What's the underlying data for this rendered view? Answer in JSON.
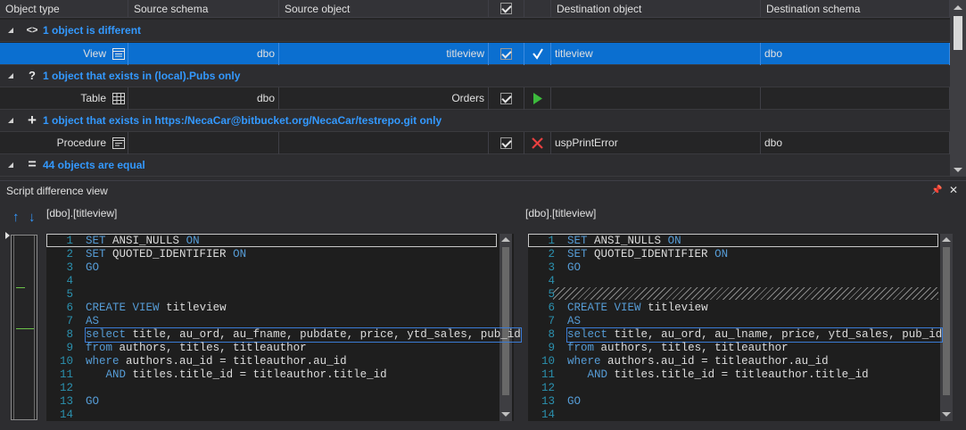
{
  "grid": {
    "columns": [
      "Object type",
      "Source schema",
      "Source object",
      "",
      "",
      "Destination object",
      "Destination schema"
    ],
    "groups": [
      {
        "label": "1 object is different",
        "icon": "<>"
      },
      {
        "label": "1 object that exists in (local).Pubs only",
        "icon": "?"
      },
      {
        "label": "1 object that exists in https:/NecaCar@bitbucket.org/NecaCar/testrepo.git only",
        "icon": "+"
      },
      {
        "label": "44 objects are equal",
        "icon": "="
      }
    ],
    "rows": [
      {
        "type": "View",
        "source_schema": "dbo",
        "source_object": "titleview",
        "dest_object": "titleview",
        "dest_schema": "dbo"
      },
      {
        "type": "Table",
        "source_schema": "dbo",
        "source_object": "Orders",
        "dest_object": "",
        "dest_schema": ""
      },
      {
        "type": "Procedure",
        "source_schema": "",
        "source_object": "",
        "dest_object": "uspPrintError",
        "dest_schema": "dbo"
      }
    ]
  },
  "panel": {
    "title": "Script difference view",
    "pin": "📌",
    "close": "✕",
    "up": "↑",
    "down": "↓",
    "left_object": "[dbo].[titleview]",
    "right_object": "[dbo].[titleview]"
  },
  "script_left": [
    {
      "n": "1",
      "t": "SET ANSI_NULLS ON"
    },
    {
      "n": "2",
      "t": "SET QUOTED_IDENTIFIER ON"
    },
    {
      "n": "3",
      "t": "GO"
    },
    {
      "n": "4",
      "t": ""
    },
    {
      "n": "5",
      "t": ""
    },
    {
      "n": "6",
      "t": "CREATE VIEW titleview"
    },
    {
      "n": "7",
      "t": "AS"
    },
    {
      "n": "8",
      "t": "select title, au_ord, au_fname, pubdate, price, ytd_sales, pub_id"
    },
    {
      "n": "9",
      "t": "from authors, titles, titleauthor"
    },
    {
      "n": "10",
      "t": "where authors.au_id = titleauthor.au_id"
    },
    {
      "n": "11",
      "t": "   AND titles.title_id = titleauthor.title_id"
    },
    {
      "n": "12",
      "t": ""
    },
    {
      "n": "13",
      "t": "GO"
    },
    {
      "n": "14",
      "t": ""
    }
  ],
  "script_right": [
    {
      "n": "1",
      "t": "SET ANSI_NULLS ON"
    },
    {
      "n": "2",
      "t": "SET QUOTED_IDENTIFIER ON"
    },
    {
      "n": "3",
      "t": "GO"
    },
    {
      "n": "4",
      "t": ""
    },
    {
      "n": "5",
      "t": ""
    },
    {
      "n": "6",
      "t": "CREATE VIEW titleview"
    },
    {
      "n": "7",
      "t": "AS"
    },
    {
      "n": "8",
      "t": "select title, au_ord, au_lname, price, ytd_sales, pub_id"
    },
    {
      "n": "9",
      "t": "from authors, titles, titleauthor"
    },
    {
      "n": "10",
      "t": "where authors.au_id = titleauthor.au_id"
    },
    {
      "n": "11",
      "t": "   AND titles.title_id = titleauthor.title_id"
    },
    {
      "n": "12",
      "t": ""
    },
    {
      "n": "13",
      "t": "GO"
    },
    {
      "n": "14",
      "t": ""
    }
  ],
  "keywords": [
    "SET",
    "ON",
    "GO",
    "CREATE",
    "VIEW",
    "AS",
    "select",
    "from",
    "where",
    "AND"
  ],
  "colors": {
    "accent": "#3399ff",
    "selection": "#0b6fd0",
    "keyword": "#569cd6",
    "line_number": "#2b91af"
  }
}
